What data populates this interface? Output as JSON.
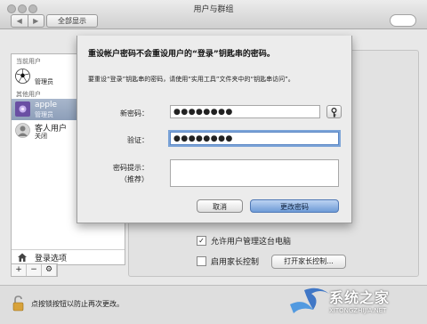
{
  "window": {
    "title": "用户与群组"
  },
  "toolbar": {
    "back": "◀",
    "forward": "▶",
    "show_all": "全部显示"
  },
  "sidebar": {
    "current_heading": "当前用户",
    "current_user": {
      "name": "",
      "role": "管理员"
    },
    "other_heading": "其他用户",
    "other_users": [
      {
        "name": "apple",
        "role": "管理员"
      },
      {
        "name": "客人用户",
        "role": "关闭"
      }
    ],
    "login_options": "登录选项",
    "buttons": [
      "+",
      "−",
      "⚙"
    ]
  },
  "panel": {
    "allow_admin": {
      "label": "允许用户管理这台电脑",
      "checked": true
    },
    "parental": {
      "label": "启用家长控制",
      "checked": false,
      "button": "打开家长控制..."
    }
  },
  "footer": {
    "lock_text": "点按锁按钮以防止再次更改。",
    "help": "?"
  },
  "sheet": {
    "title": "重设帐户密码不会重设用户的“登录”钥匙串的密码。",
    "description": "要重设“登录”钥匙串的密码，请使用“实用工具”文件夹中的“钥匙串访问”。",
    "new_password_label": "新密码：",
    "new_password_value": "●●●●●●●●",
    "verify_label": "验证：",
    "verify_value": "●●●●●●●●",
    "hint_label": "密码提示：",
    "hint_sub": "（推荐）",
    "hint_value": "",
    "key_icon": "key-icon",
    "cancel": "取消",
    "change": "更改密码"
  },
  "watermark": {
    "text": "系统之家",
    "url": "XITONGZHIJIA.NET"
  }
}
